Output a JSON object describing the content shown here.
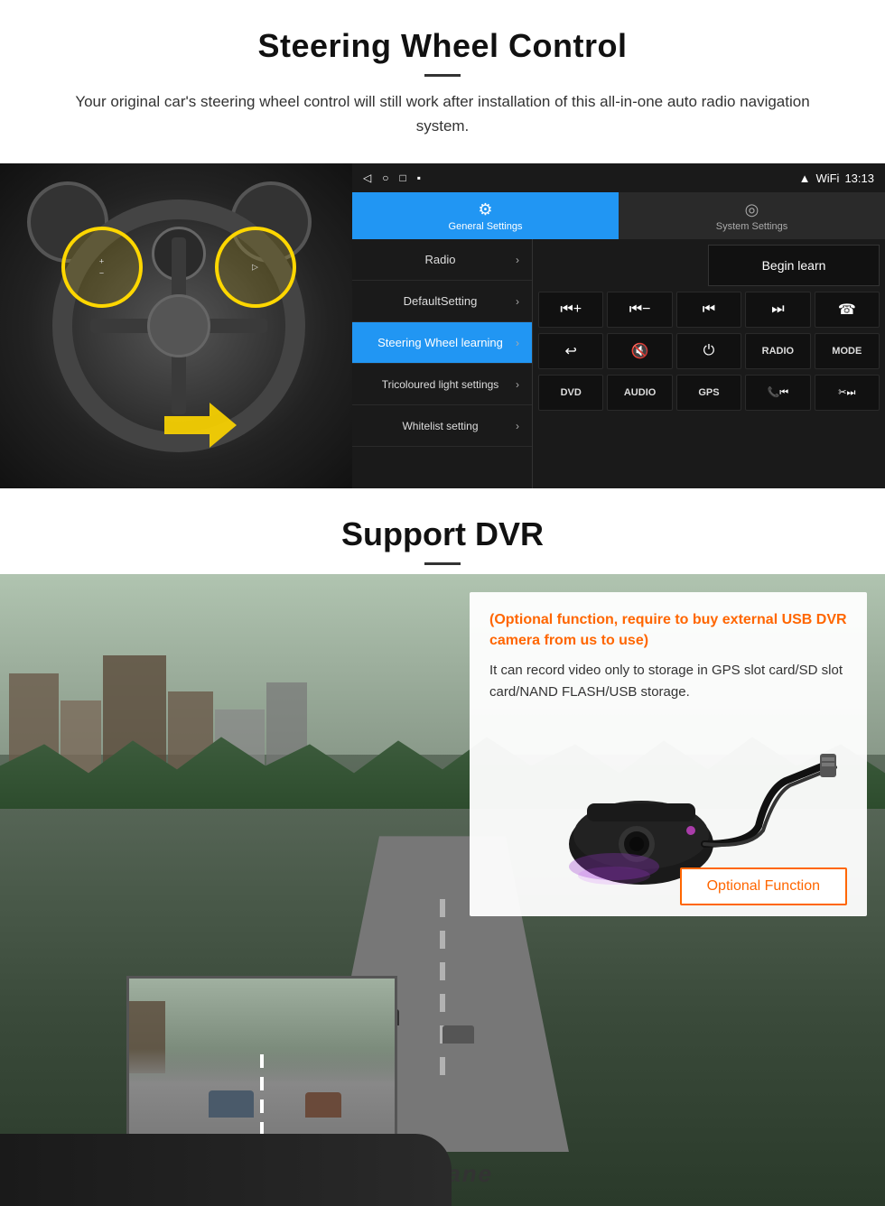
{
  "steering_section": {
    "title": "Steering Wheel Control",
    "subtitle": "Your original car's steering wheel control will still work after installation of this all-in-one auto radio navigation system.",
    "statusbar": {
      "nav_back": "◁",
      "nav_home": "○",
      "nav_square": "□",
      "nav_menu": "▪",
      "signal": "▼",
      "wifi": "▾",
      "time": "13:13"
    },
    "tabs": [
      {
        "icon": "⚙",
        "label": "General Settings",
        "active": true
      },
      {
        "icon": "◎",
        "label": "System Settings",
        "active": false
      }
    ],
    "menu_items": [
      {
        "label": "Radio",
        "active": false
      },
      {
        "label": "DefaultSetting",
        "active": false
      },
      {
        "label": "Steering Wheel learning",
        "active": true
      },
      {
        "label": "Tricoloured light settings",
        "active": false
      },
      {
        "label": "Whitelist setting",
        "active": false
      }
    ],
    "begin_learn": "Begin learn",
    "control_buttons_row1": [
      {
        "symbol": "⏮+",
        "label": "vol up prev"
      },
      {
        "symbol": "⏮-",
        "label": "vol down prev"
      },
      {
        "symbol": "⏮",
        "label": "prev track"
      },
      {
        "symbol": "⏭",
        "label": "next track"
      },
      {
        "symbol": "☎",
        "label": "phone"
      }
    ],
    "control_buttons_row2": [
      {
        "symbol": "↩",
        "label": "back"
      },
      {
        "symbol": "🔇",
        "label": "mute"
      },
      {
        "symbol": "⏻",
        "label": "power"
      },
      {
        "symbol": "RADIO",
        "label": "radio"
      },
      {
        "symbol": "MODE",
        "label": "mode"
      }
    ],
    "control_buttons_row3": [
      {
        "symbol": "DVD",
        "label": "dvd"
      },
      {
        "symbol": "AUDIO",
        "label": "audio"
      },
      {
        "symbol": "GPS",
        "label": "gps"
      },
      {
        "symbol": "📞⏮",
        "label": "call prev"
      },
      {
        "symbol": "✂⏭",
        "label": "cut next"
      }
    ]
  },
  "dvr_section": {
    "title": "Support DVR",
    "optional_text": "(Optional function, require to buy external USB DVR camera from us to use)",
    "description": "It can record video only to storage in GPS slot card/SD slot card/NAND FLASH/USB storage.",
    "optional_function_label": "Optional Function",
    "seicane_brand": "Seicane"
  }
}
